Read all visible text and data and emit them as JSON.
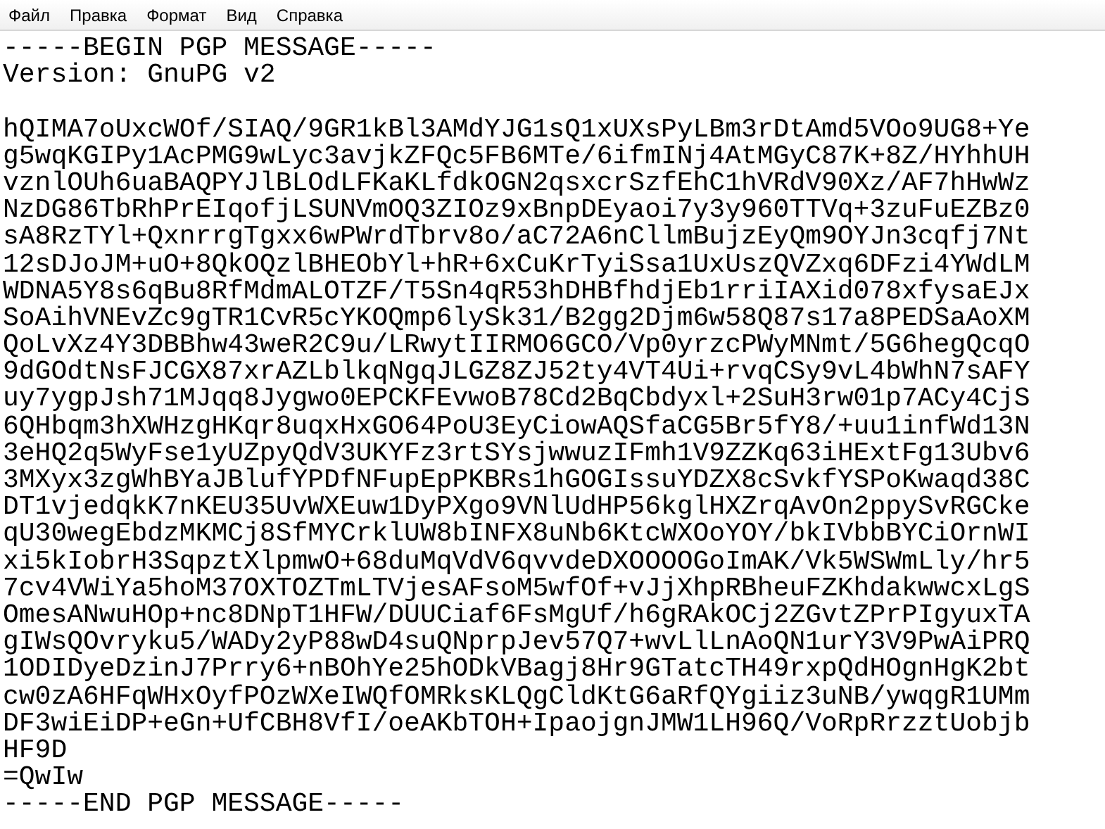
{
  "menu": [
    {
      "label": "Файл"
    },
    {
      "label": "Правка"
    },
    {
      "label": "Формат"
    },
    {
      "label": "Вид"
    },
    {
      "label": "Справка"
    }
  ],
  "header": [
    "-----BEGIN PGP MESSAGE-----",
    "Version: GnuPG v2"
  ],
  "body": [
    "hQIMA7oUxcWOf/SIAQ/9GR1kBl3AMdYJG1sQ1xUXsPyLBm3rDtAmd5VOo9UG8+Ye",
    "g5wqKGIPy1AcPMG9wLyc3avjkZFQc5FB6MTe/6ifmINj4AtMGyC87K+8Z/HYhhUH",
    "vznlOUh6uaBAQPYJlBLOdLFKaKLfdkOGN2qsxcrSzfEhC1hVRdV90Xz/AF7hHwWz",
    "NzDG86TbRhPrEIqofjLSUNVmOQ3ZIOz9xBnpDEyaoi7y3y960TTVq+3zuFuEZBz0",
    "sA8RzTYl+QxnrrgTgxx6wPWrdTbrv8o/aC72A6nCllmBujzEyQm9OYJn3cqfj7Nt",
    "12sDJoJM+uO+8QkOQzlBHEObYl+hR+6xCuKrTyiSsa1UxUszQVZxq6DFzi4YWdLM",
    "WDNA5Y8s6qBu8RfMdmALOTZF/T5Sn4qR53hDHBfhdjEb1rriIAXid078xfysaEJx",
    "SoAihVNEvZc9gTR1CvR5cYKOQmp6lySk31/B2gg2Djm6w58Q87s17a8PEDSaAoXM",
    "QoLvXz4Y3DBBhw43weR2C9u/LRwytIIRMO6GCO/Vp0yrzcPWyMNmt/5G6hegQcqO",
    "9dGOdtNsFJCGX87xrAZLblkqNgqJLGZ8ZJ52ty4VT4Ui+rvqCSy9vL4bWhN7sAFY",
    "uy7ygpJsh71MJqq8Jygwo0EPCKFEvwoB78Cd2BqCbdyxl+2SuH3rw01p7ACy4CjS",
    "6QHbqm3hXWHzgHKqr8uqxHxGO64PoU3EyCiowAQSfaCG5Br5fY8/+uu1infWd13N",
    "3eHQ2q5WyFse1yUZpyQdV3UKYFz3rtSYsjwwuzIFmh1V9ZZKq63iHExtFg13Ubv6",
    "3MXyx3zgWhBYaJBlufYPDfNFupEpPKBRs1hGOGIssuYDZX8cSvkfYSPoKwaqd38C",
    "DT1vjedqkK7nKEU35UvWXEuw1DyPXgo9VNlUdHP56kglHXZrqAvOn2ppySvRGCke",
    "qU30wegEbdzMKMCj8SfMYCrklUW8bINFX8uNb6KtcWXOoYOY/bkIVbbBYCiOrnWI",
    "xi5kIobrH3SqpztXlpmwO+68duMqVdV6qvvdeDXOOOOGoImAK/Vk5WSWmLly/hr5",
    "7cv4VWiYa5hoM37OXTOZTmLTVjesAFsoM5wfOf+vJjXhpRBheuFZKhdakwwcxLgS",
    "OmesANwuHOp+nc8DNpT1HFW/DUUCiaf6FsMgUf/h6gRAkOCj2ZGvtZPrPIgyuxTA",
    "gIWsQOvryku5/WADy2yP88wD4suQNprpJev57Q7+wvLlLnAoQN1urY3V9PwAiPRQ",
    "1ODIDyeDzinJ7Prry6+nBOhYe25hODkVBagj8Hr9GTatcTH49rxpQdHOgnHgK2bt",
    "cw0zA6HFqWHxOyfPOzWXeIWQfOMRksKLQgCldKtG6aRfQYgiiz3uNB/ywqgR1UMm",
    "DF3wiEiDP+eGn+UfCBH8VfI/oeAKbTOH+IpaojgnJMW1LH96Q/VoRpRrzztUobjb",
    "HF9D"
  ],
  "checksum": "=QwIw",
  "footer": "-----END PGP MESSAGE-----"
}
